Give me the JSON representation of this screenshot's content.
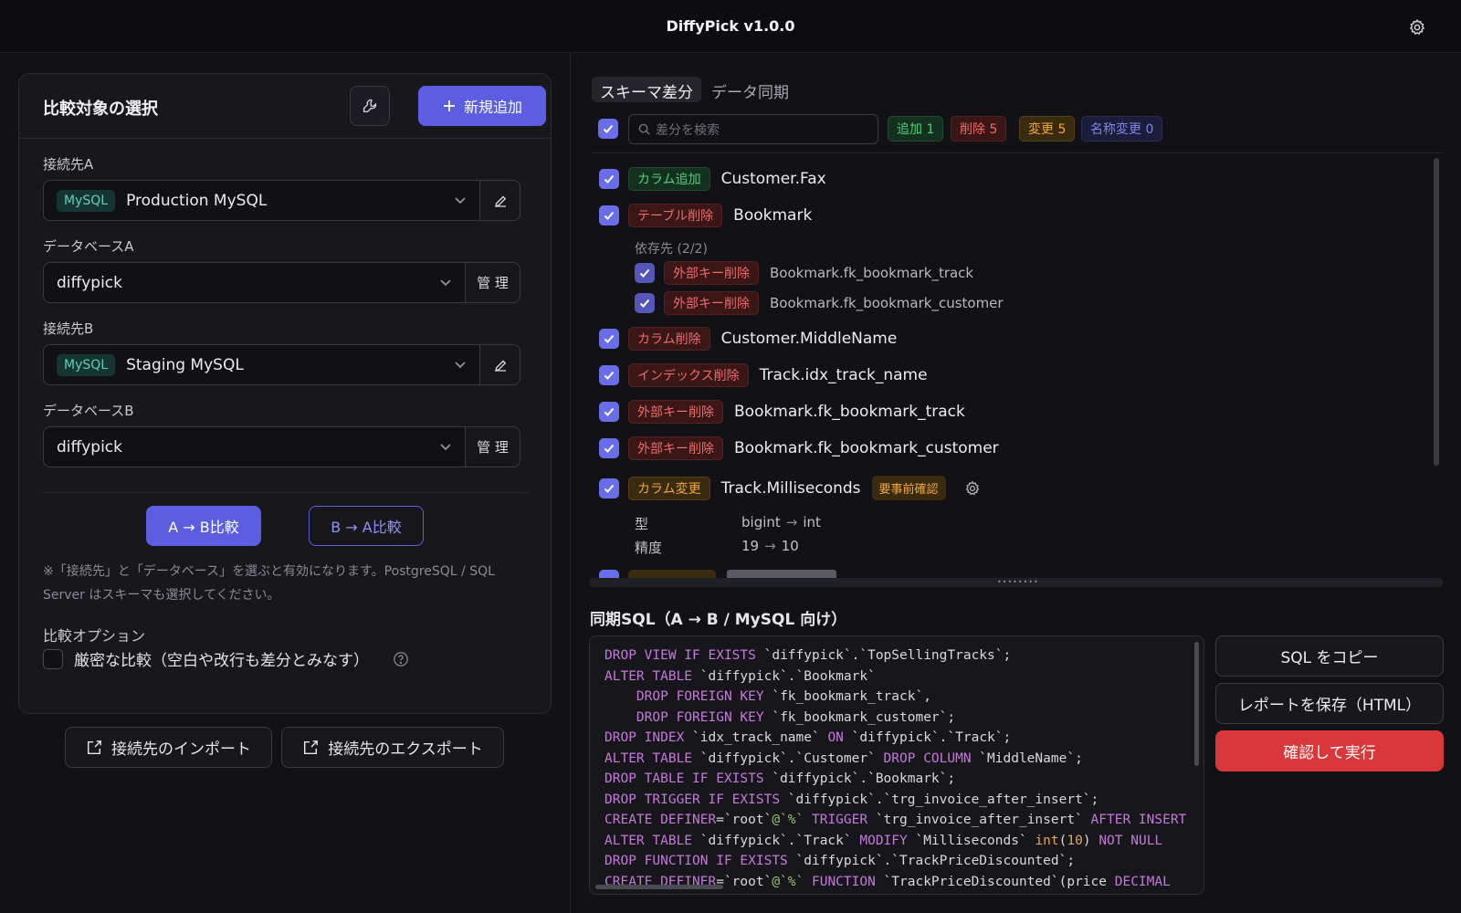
{
  "app": {
    "title": "DiffyPick v1.0.0"
  },
  "left": {
    "card_title": "比較対象の選択",
    "new_button": "新規追加",
    "conn_a_label": "接続先A",
    "conn_a_type": "MySQL",
    "conn_a_value": "Production MySQL",
    "db_a_label": "データベースA",
    "db_a_value": "diffypick",
    "manage_label": "管 理",
    "conn_b_label": "接続先B",
    "conn_b_type": "MySQL",
    "conn_b_value": "Staging MySQL",
    "db_b_label": "データベースB",
    "db_b_value": "diffypick",
    "compare_ab": "A → B比較",
    "compare_ba": "B → A比較",
    "note": "※「接続先」と「データベース」を選ぶと有効になります。PostgreSQL / SQL Server はスキーマも選択してください。",
    "options_title": "比較オプション",
    "strict_label": "厳密な比較（空白や改行も差分とみなす）",
    "import_button": "接続先のインポート",
    "export_button": "接続先のエクスポート"
  },
  "right": {
    "tabs": [
      "スキーマ差分",
      "データ同期"
    ],
    "search_placeholder": "差分を検索",
    "counts": {
      "add": "追加 1",
      "delete": "削除 5",
      "change": "変更 5",
      "rename": "名称変更 0"
    },
    "items": [
      {
        "tag": "カラム追加",
        "name": "Customer.Fax"
      },
      {
        "tag": "テーブル削除",
        "name": "Bookmark"
      },
      {
        "tag": "外部キー削除",
        "name": "Bookmark.fk_bookmark_track"
      },
      {
        "tag": "外部キー削除",
        "name": "Bookmark.fk_bookmark_customer"
      },
      {
        "tag": "カラム削除",
        "name": "Customer.MiddleName"
      },
      {
        "tag": "インデックス削除",
        "name": "Track.idx_track_name"
      },
      {
        "tag": "外部キー削除",
        "name": "Bookmark.fk_bookmark_track"
      },
      {
        "tag": "外部キー削除",
        "name": "Bookmark.fk_bookmark_customer"
      },
      {
        "tag": "カラム変更",
        "name": "Track.Milliseconds"
      }
    ],
    "dependency_label": "依存先 (2/2)",
    "warning_badge": "要事前確認",
    "detail": {
      "type_key": "型",
      "type_from": "bigint",
      "type_to": "int",
      "precision_key": "精度",
      "precision_from": "19",
      "precision_to": "10"
    },
    "sql_title": "同期SQL（A → B / MySQL 向け）",
    "copy_button": "SQL をコピー",
    "save_button": "レポートを保存（HTML）",
    "execute_button": "確認して実行"
  },
  "colors": {
    "accent": "#5b5ee0",
    "danger": "#d9373a"
  },
  "icons": [
    "gear-icon",
    "wrench-icon",
    "plus-icon",
    "pencil-icon",
    "chevron-down-icon",
    "help-icon",
    "import-icon",
    "export-icon",
    "search-icon",
    "check-icon"
  ]
}
